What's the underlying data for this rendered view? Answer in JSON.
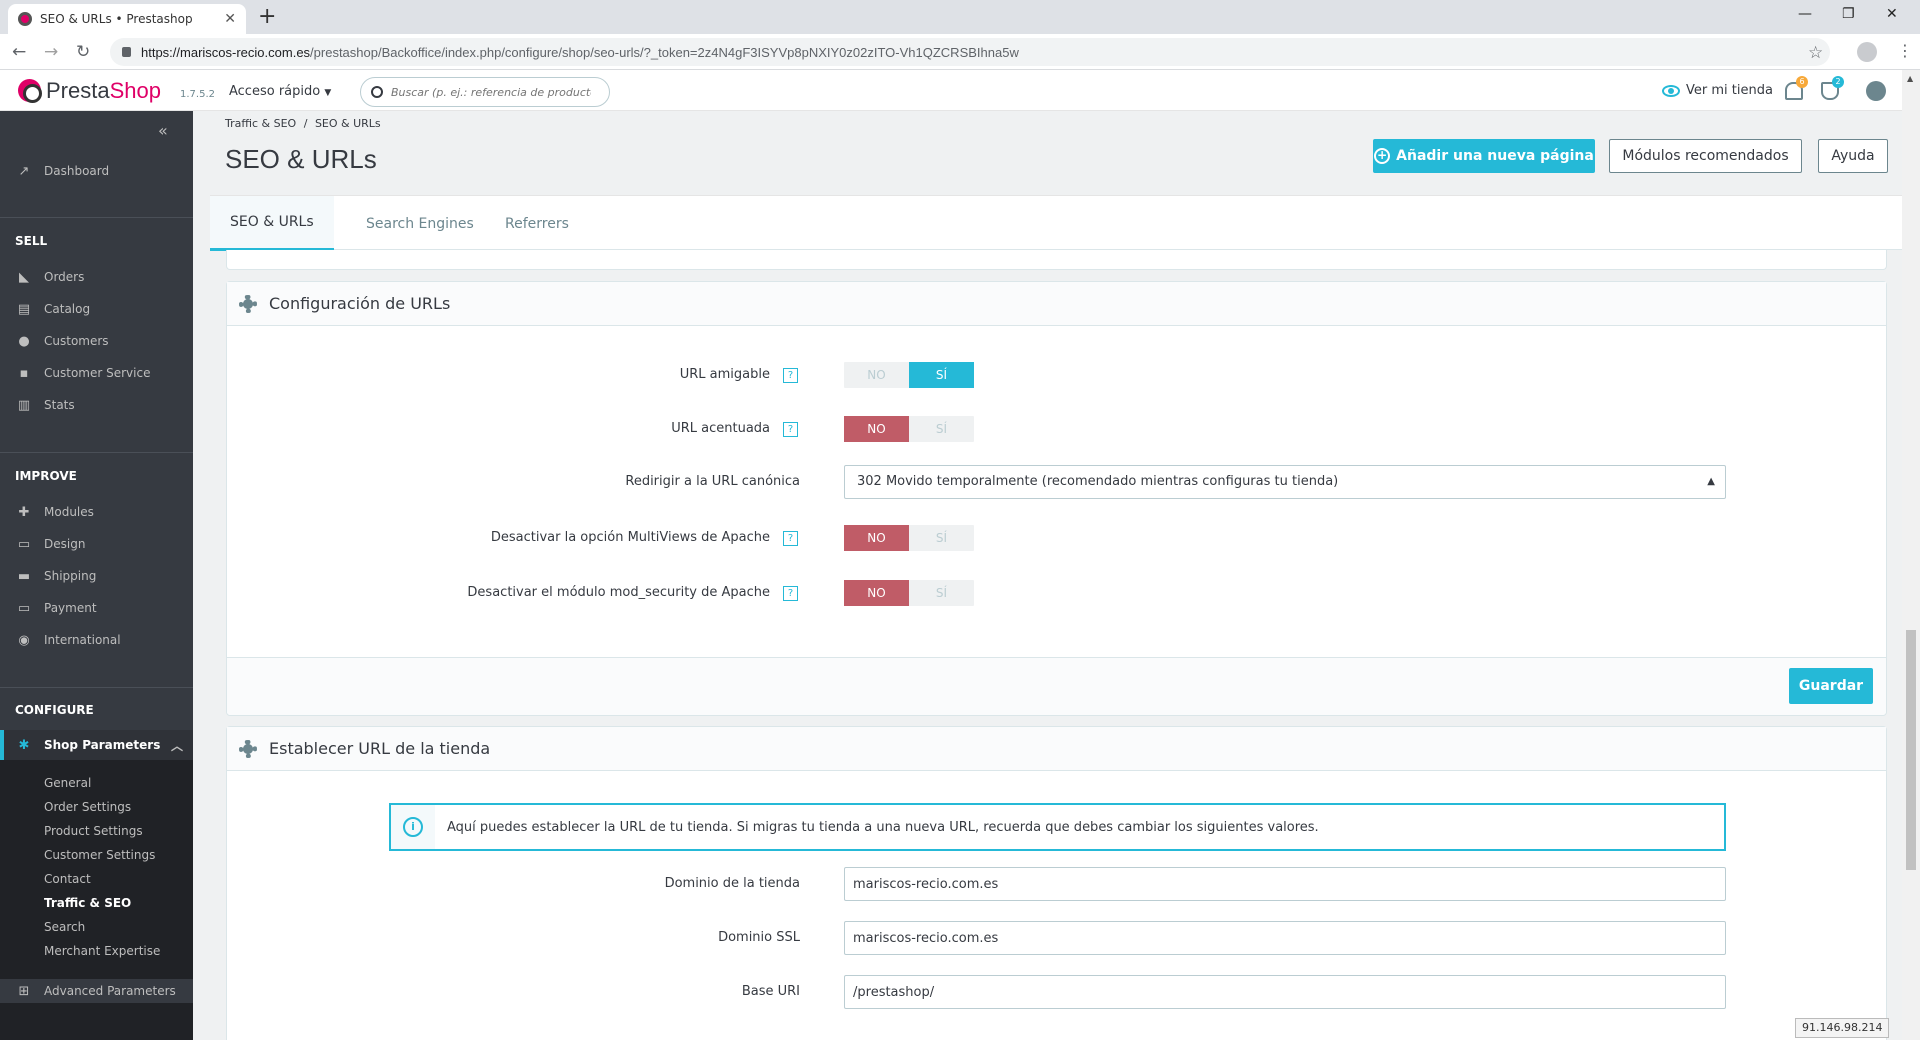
{
  "browser": {
    "tab_title": "SEO & URLs • Prestashop",
    "new_tab": "+",
    "url_host": "https://mariscos-recio.com.es",
    "url_path": "/prestashop/Backoffice/index.php/configure/shop/seo-urls/?_token=2z4N4gF3ISYVp8pNXIY0z02zITO-Vh1QZCRSBIhna5w"
  },
  "header": {
    "logo_part1": "Presta",
    "logo_part2": "Shop",
    "version": "1.7.5.2",
    "quick_access": "Acceso rápido",
    "search_placeholder": "Buscar (p. ej.: referencia de producto, no",
    "view_store": "Ver mi tienda",
    "notif_count": "6",
    "orders_count": "2"
  },
  "sidebar": {
    "dashboard": "Dashboard",
    "sell": "SELL",
    "orders": "Orders",
    "catalog": "Catalog",
    "customers": "Customers",
    "customer_service": "Customer Service",
    "stats": "Stats",
    "improve": "IMPROVE",
    "modules": "Modules",
    "design": "Design",
    "shipping": "Shipping",
    "payment": "Payment",
    "international": "International",
    "configure": "CONFIGURE",
    "shop_parameters": "Shop Parameters",
    "sub": [
      "General",
      "Order Settings",
      "Product Settings",
      "Customer Settings",
      "Contact",
      "Traffic & SEO",
      "Search",
      "Merchant Expertise"
    ],
    "advanced": "Advanced Parameters"
  },
  "page": {
    "breadcrumb_1": "Traffic & SEO",
    "breadcrumb_sep": "/",
    "breadcrumb_2": "SEO & URLs",
    "title": "SEO & URLs",
    "btn_add": "Añadir una nueva página",
    "btn_modules": "Módulos recomendados",
    "btn_help": "Ayuda",
    "tabs": [
      "SEO & URLs",
      "Search Engines",
      "Referrers"
    ]
  },
  "url_config": {
    "title": "Configuración de URLs",
    "no": "NO",
    "yes": "SÍ",
    "help_mark": "?",
    "friendly_url": "URL amigable",
    "accented_url": "URL acentuada",
    "canonical": "Redirigir a la URL canónica",
    "canonical_value": "302 Movido temporalmente (recomendado mientras configuras tu tienda)",
    "multiviews": "Desactivar la opción MultiViews de Apache",
    "mod_security": "Desactivar el módulo mod_security de Apache",
    "save": "Guardar"
  },
  "shop_url": {
    "title": "Establecer URL de la tienda",
    "info": "Aquí puedes establecer la URL de tu tienda. Si migras tu tienda a una nueva URL, recuerda que debes cambiar los siguientes valores.",
    "info_icon": "i",
    "domain_label": "Dominio de la tienda",
    "domain_value": "mariscos-recio.com.es",
    "ssl_label": "Dominio SSL",
    "ssl_value": "mariscos-recio.com.es",
    "base_label": "Base URI",
    "base_value": "/prestashop/"
  },
  "footer_ip": "91.146.98.214",
  "colors": {
    "accent": "#25b9d7",
    "danger": "#c05c67",
    "sidebar": "#363a41",
    "brand": "#df0067"
  }
}
